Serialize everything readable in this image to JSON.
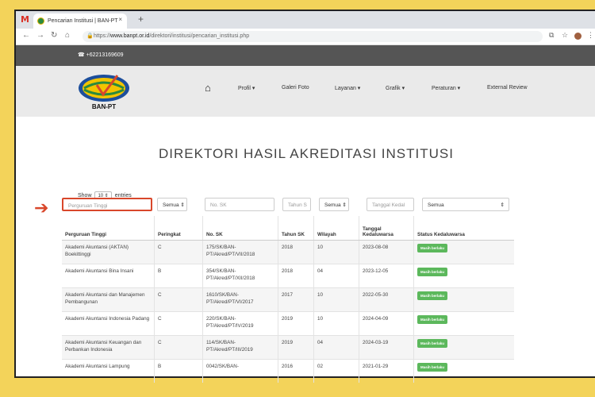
{
  "browser": {
    "tab_title": "Pencarian Institusi | BAN-PT",
    "tab_close": "×",
    "new_tab": "+",
    "url_prefix": "https://",
    "url_domain": "www.banpt.or.id",
    "url_path": "/direktori/institusi/pencarian_institusi.php"
  },
  "topbar": {
    "phone": "☎ +62213169609"
  },
  "logo_text": "BAN-PT",
  "nav": {
    "items": [
      "Profil ▾",
      "Galeri Foto",
      "Layanan ▾",
      "Grafik ▾",
      "Peraturan ▾",
      "External Review"
    ]
  },
  "page": {
    "title": "DIREKTORI HASIL AKREDITASI INSTITUSI"
  },
  "show": {
    "prefix": "Show",
    "value": "10 ⇕",
    "suffix": "entries"
  },
  "filters": {
    "pt_placeholder": "Perguruan Tinggi",
    "peringkat": "Semua ⇕",
    "nosk_placeholder": "No. SK",
    "tahun_placeholder": "Tahun S",
    "wilayah": "Semua ⇕",
    "tgl_placeholder": "Tanggal Kedal",
    "status": "Semua",
    "status_caret": "⇕"
  },
  "table": {
    "headers": [
      "Perguruan Tinggi",
      "Peringkat",
      "No. SK",
      "Tahun SK",
      "Wilayah",
      "Tanggal Kedaluwarsa",
      "Status Kedaluwarsa"
    ],
    "rows": [
      [
        "Akademi Akuntansi (AKTAN) Boekittinggi",
        "C",
        "175/SK/BAN-PT/Akred/PT/VII/2018",
        "2018",
        "10",
        "2023-08-08",
        "Masih berlaku"
      ],
      [
        "Akademi Akuntansi Bina Insani",
        "B",
        "354/SK/BAN-PT/Akred/PT/XII/2018",
        "2018",
        "04",
        "2023-12-05",
        "Masih berlaku"
      ],
      [
        "Akademi Akuntansi dan Manajemen Pembangunan",
        "C",
        "1610/SK/BAN-PT/Akred/PT/VI/2017",
        "2017",
        "10",
        "2022-05-30",
        "Masih berlaku"
      ],
      [
        "Akademi Akuntansi Indonesia Padang",
        "C",
        "220/SK/BAN-PT/Akred/PT/IV/2019",
        "2019",
        "10",
        "2024-04-09",
        "Masih berlaku"
      ],
      [
        "Akademi Akuntansi Keuangan dan Perbankan Indonesia",
        "C",
        "114/SK/BAN-PT/Akred/PT/III/2019",
        "2019",
        "04",
        "2024-03-19",
        "Masih berlaku"
      ],
      [
        "Akademi Akuntansi Lampung",
        "B",
        "0042/SK/BAN-",
        "2016",
        "02",
        "2021-01-29",
        "Masih berlaku"
      ]
    ]
  }
}
